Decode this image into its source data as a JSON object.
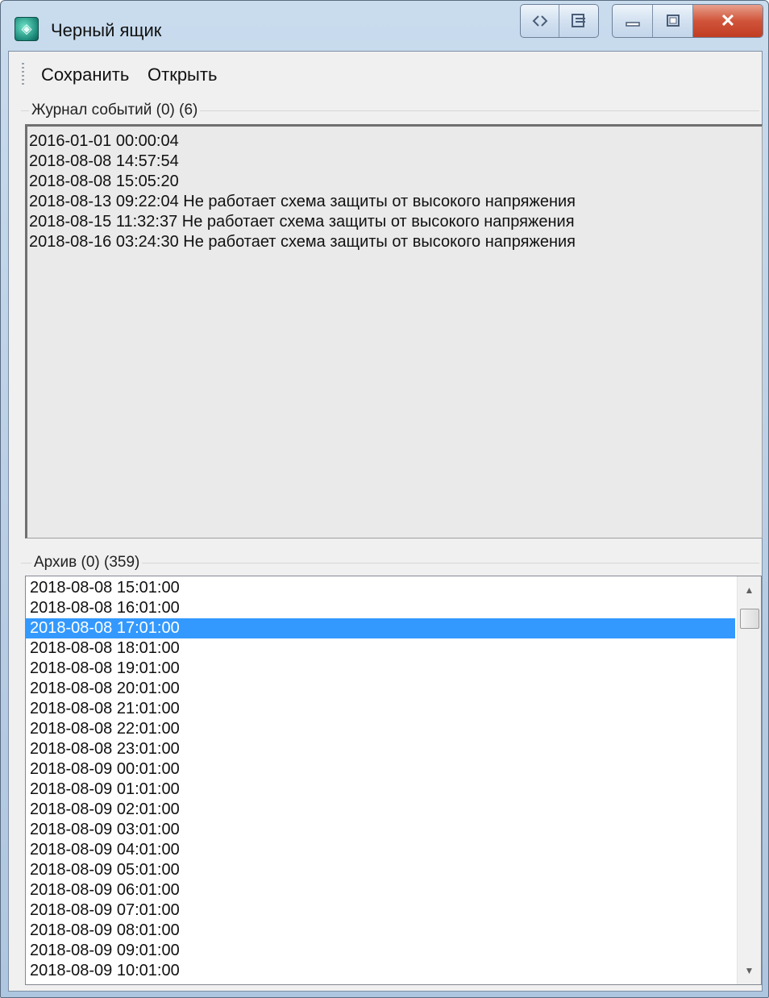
{
  "window": {
    "title": "Черный ящик",
    "caption_icons": [
      "drag-handle-icon",
      "restore-icon",
      "minimize-icon",
      "maximize-icon",
      "close-icon"
    ]
  },
  "menu": {
    "save": "Сохранить",
    "open": "Открыть"
  },
  "events": {
    "label": "Журнал событий (0) (6)",
    "lines": [
      "2016-01-01 00:00:04",
      "2018-08-08 14:57:54",
      "2018-08-08 15:05:20",
      "2018-08-13 09:22:04 Не работает схема защиты от высокого напряжения",
      "2018-08-15 11:32:37 Не работает схема защиты от высокого напряжения",
      "2018-08-16 03:24:30 Не работает схема защиты от высокого напряжения"
    ]
  },
  "archive": {
    "label": "Архив (0) (359)",
    "selected_index": 2,
    "items": [
      "2018-08-08 15:01:00",
      "2018-08-08 16:01:00",
      "2018-08-08 17:01:00",
      "2018-08-08 18:01:00",
      "2018-08-08 19:01:00",
      "2018-08-08 20:01:00",
      "2018-08-08 21:01:00",
      "2018-08-08 22:01:00",
      "2018-08-08 23:01:00",
      "2018-08-09 00:01:00",
      "2018-08-09 01:01:00",
      "2018-08-09 02:01:00",
      "2018-08-09 03:01:00",
      "2018-08-09 04:01:00",
      "2018-08-09 05:01:00",
      "2018-08-09 06:01:00",
      "2018-08-09 07:01:00",
      "2018-08-09 08:01:00",
      "2018-08-09 09:01:00",
      "2018-08-09 10:01:00"
    ]
  },
  "colors": {
    "selection": "#3399ff",
    "close_button": "#c13d22"
  }
}
